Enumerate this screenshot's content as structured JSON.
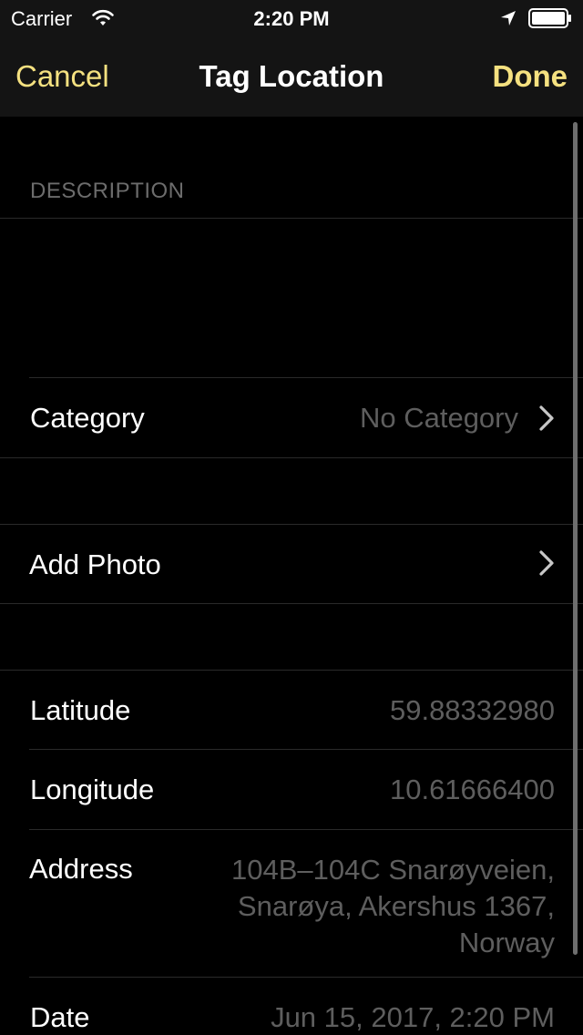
{
  "status_bar": {
    "carrier": "Carrier",
    "time": "2:20 PM"
  },
  "nav": {
    "cancel_label": "Cancel",
    "title": "Tag Location",
    "done_label": "Done"
  },
  "form": {
    "description_header": "DESCRIPTION",
    "description_value": "",
    "category": {
      "label": "Category",
      "value": "No Category"
    },
    "photo": {
      "label": "Add Photo"
    },
    "latitude": {
      "label": "Latitude",
      "value": "59.88332980"
    },
    "longitude": {
      "label": "Longitude",
      "value": "10.61666400"
    },
    "address": {
      "label": "Address",
      "lines": [
        "104B–104C Snarøyveien,",
        "Snarøya, Akershus 1367,",
        "Norway"
      ]
    },
    "date": {
      "label": "Date",
      "value": "Jun 15, 2017, 2:20 PM"
    }
  },
  "colors": {
    "accent": "#f5e180",
    "background": "#000000",
    "nav_background": "#141414",
    "secondary_text": "#5e5e5e"
  },
  "icons": {
    "wifi": "wifi-icon",
    "location": "location-arrow-icon",
    "battery": "battery-icon",
    "chevron": "chevron-right-icon"
  }
}
